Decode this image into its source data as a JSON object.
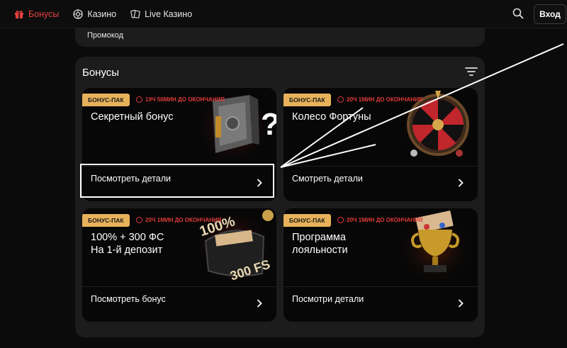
{
  "nav": {
    "items": [
      {
        "label": "Бонусы",
        "icon": "gift-icon",
        "active": true
      },
      {
        "label": "Казино",
        "icon": "chip-icon",
        "active": false
      },
      {
        "label": "Live Казино",
        "icon": "cards-icon",
        "active": false
      }
    ],
    "login_label": "Вход"
  },
  "promo": {
    "label": "Промокод"
  },
  "bonuses": {
    "title": "Бонусы",
    "cards": [
      {
        "badge": "БОНУС-ПАК",
        "timer": "19Ч 56МИН ДО ОКОНЧАНИЯ",
        "title": "Секретный бонус",
        "action": "Посмотреть детали",
        "art": "safe-icon"
      },
      {
        "badge": "БОНУС-ПАК",
        "timer": "20Ч 1МИН ДО ОКОНЧАНИЯ",
        "title": "Колесо Фортуны",
        "action": "Смотреть детали",
        "art": "roulette-wheel-icon"
      },
      {
        "badge": "БОНУС-ПАК",
        "timer": "20Ч 1МИН ДО ОКОНЧАНИЯ",
        "title": "100% + 300 ФС\nНа 1-й депозит",
        "action": "Посмотреть бонус",
        "art": "money-bag-icon",
        "art_text": [
          "100%",
          "300 FS"
        ]
      },
      {
        "badge": "БОНУС-ПАК",
        "timer": "20Ч 1МИН ДО ОКОНЧАНИЯ",
        "title": "Программа\nлояльности",
        "action": "Посмотри детали",
        "art": "trophy-icon"
      }
    ]
  },
  "colors": {
    "accent_red": "#e8403f",
    "badge_gold": "#e7b25a",
    "timer_red": "#e03a3a",
    "panel": "#1c1c1c",
    "card": "#070707"
  }
}
